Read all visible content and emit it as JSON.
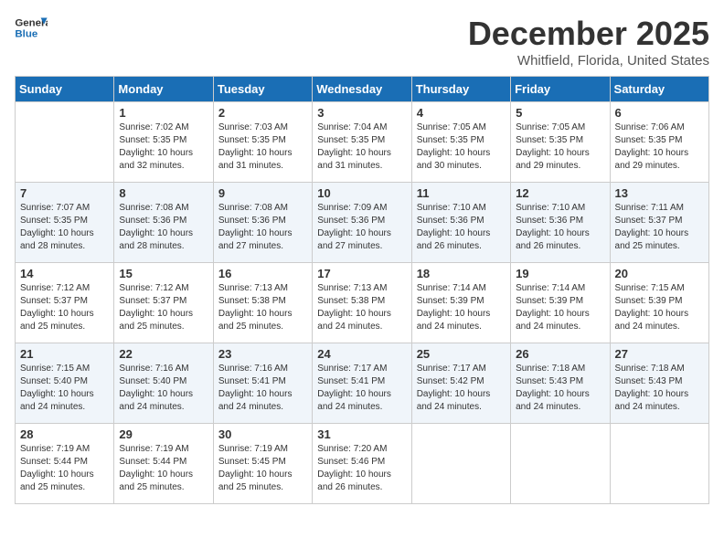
{
  "header": {
    "logo_general": "General",
    "logo_blue": "Blue",
    "month": "December 2025",
    "location": "Whitfield, Florida, United States"
  },
  "days_of_week": [
    "Sunday",
    "Monday",
    "Tuesday",
    "Wednesday",
    "Thursday",
    "Friday",
    "Saturday"
  ],
  "weeks": [
    [
      {
        "day": "",
        "info": ""
      },
      {
        "day": "1",
        "info": "Sunrise: 7:02 AM\nSunset: 5:35 PM\nDaylight: 10 hours\nand 32 minutes."
      },
      {
        "day": "2",
        "info": "Sunrise: 7:03 AM\nSunset: 5:35 PM\nDaylight: 10 hours\nand 31 minutes."
      },
      {
        "day": "3",
        "info": "Sunrise: 7:04 AM\nSunset: 5:35 PM\nDaylight: 10 hours\nand 31 minutes."
      },
      {
        "day": "4",
        "info": "Sunrise: 7:05 AM\nSunset: 5:35 PM\nDaylight: 10 hours\nand 30 minutes."
      },
      {
        "day": "5",
        "info": "Sunrise: 7:05 AM\nSunset: 5:35 PM\nDaylight: 10 hours\nand 29 minutes."
      },
      {
        "day": "6",
        "info": "Sunrise: 7:06 AM\nSunset: 5:35 PM\nDaylight: 10 hours\nand 29 minutes."
      }
    ],
    [
      {
        "day": "7",
        "info": "Sunrise: 7:07 AM\nSunset: 5:35 PM\nDaylight: 10 hours\nand 28 minutes."
      },
      {
        "day": "8",
        "info": "Sunrise: 7:08 AM\nSunset: 5:36 PM\nDaylight: 10 hours\nand 28 minutes."
      },
      {
        "day": "9",
        "info": "Sunrise: 7:08 AM\nSunset: 5:36 PM\nDaylight: 10 hours\nand 27 minutes."
      },
      {
        "day": "10",
        "info": "Sunrise: 7:09 AM\nSunset: 5:36 PM\nDaylight: 10 hours\nand 27 minutes."
      },
      {
        "day": "11",
        "info": "Sunrise: 7:10 AM\nSunset: 5:36 PM\nDaylight: 10 hours\nand 26 minutes."
      },
      {
        "day": "12",
        "info": "Sunrise: 7:10 AM\nSunset: 5:36 PM\nDaylight: 10 hours\nand 26 minutes."
      },
      {
        "day": "13",
        "info": "Sunrise: 7:11 AM\nSunset: 5:37 PM\nDaylight: 10 hours\nand 25 minutes."
      }
    ],
    [
      {
        "day": "14",
        "info": "Sunrise: 7:12 AM\nSunset: 5:37 PM\nDaylight: 10 hours\nand 25 minutes."
      },
      {
        "day": "15",
        "info": "Sunrise: 7:12 AM\nSunset: 5:37 PM\nDaylight: 10 hours\nand 25 minutes."
      },
      {
        "day": "16",
        "info": "Sunrise: 7:13 AM\nSunset: 5:38 PM\nDaylight: 10 hours\nand 25 minutes."
      },
      {
        "day": "17",
        "info": "Sunrise: 7:13 AM\nSunset: 5:38 PM\nDaylight: 10 hours\nand 24 minutes."
      },
      {
        "day": "18",
        "info": "Sunrise: 7:14 AM\nSunset: 5:39 PM\nDaylight: 10 hours\nand 24 minutes."
      },
      {
        "day": "19",
        "info": "Sunrise: 7:14 AM\nSunset: 5:39 PM\nDaylight: 10 hours\nand 24 minutes."
      },
      {
        "day": "20",
        "info": "Sunrise: 7:15 AM\nSunset: 5:39 PM\nDaylight: 10 hours\nand 24 minutes."
      }
    ],
    [
      {
        "day": "21",
        "info": "Sunrise: 7:15 AM\nSunset: 5:40 PM\nDaylight: 10 hours\nand 24 minutes."
      },
      {
        "day": "22",
        "info": "Sunrise: 7:16 AM\nSunset: 5:40 PM\nDaylight: 10 hours\nand 24 minutes."
      },
      {
        "day": "23",
        "info": "Sunrise: 7:16 AM\nSunset: 5:41 PM\nDaylight: 10 hours\nand 24 minutes."
      },
      {
        "day": "24",
        "info": "Sunrise: 7:17 AM\nSunset: 5:41 PM\nDaylight: 10 hours\nand 24 minutes."
      },
      {
        "day": "25",
        "info": "Sunrise: 7:17 AM\nSunset: 5:42 PM\nDaylight: 10 hours\nand 24 minutes."
      },
      {
        "day": "26",
        "info": "Sunrise: 7:18 AM\nSunset: 5:43 PM\nDaylight: 10 hours\nand 24 minutes."
      },
      {
        "day": "27",
        "info": "Sunrise: 7:18 AM\nSunset: 5:43 PM\nDaylight: 10 hours\nand 24 minutes."
      }
    ],
    [
      {
        "day": "28",
        "info": "Sunrise: 7:19 AM\nSunset: 5:44 PM\nDaylight: 10 hours\nand 25 minutes."
      },
      {
        "day": "29",
        "info": "Sunrise: 7:19 AM\nSunset: 5:44 PM\nDaylight: 10 hours\nand 25 minutes."
      },
      {
        "day": "30",
        "info": "Sunrise: 7:19 AM\nSunset: 5:45 PM\nDaylight: 10 hours\nand 25 minutes."
      },
      {
        "day": "31",
        "info": "Sunrise: 7:20 AM\nSunset: 5:46 PM\nDaylight: 10 hours\nand 26 minutes."
      },
      {
        "day": "",
        "info": ""
      },
      {
        "day": "",
        "info": ""
      },
      {
        "day": "",
        "info": ""
      }
    ]
  ]
}
